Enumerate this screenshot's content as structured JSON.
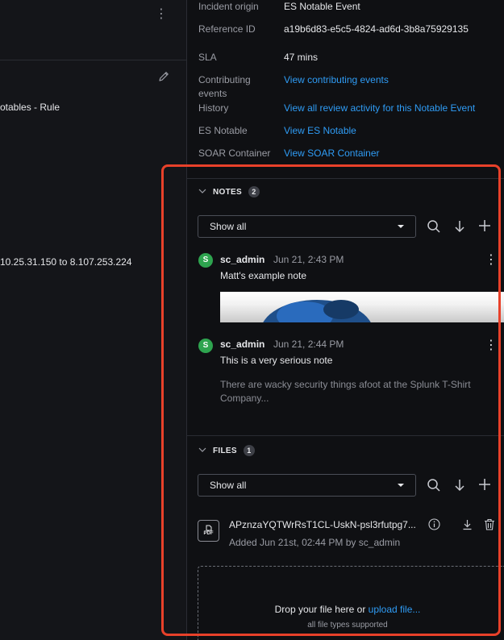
{
  "left": {
    "kebab": "⋮",
    "rule_text": "otables - Rule",
    "ip_text": "10.25.31.150 to 8.107.253.224"
  },
  "details": {
    "incident_origin": {
      "label": "Incident origin",
      "value": "ES Notable Event"
    },
    "reference_id": {
      "label": "Reference ID",
      "value": "a19b6d83-e5c5-4824-ad6d-3b8a75929135"
    },
    "sla": {
      "label": "SLA",
      "value": "47 mins"
    },
    "contributing": {
      "label_line1": "Contributing",
      "label_line2": "events",
      "value": "View contributing events"
    },
    "history": {
      "label": "History",
      "value": "View all review activity for this Notable Event"
    },
    "es_notable": {
      "label": "ES Notable",
      "value": "View ES Notable"
    },
    "soar_container": {
      "label": "SOAR Container",
      "value": "View SOAR Container"
    }
  },
  "notes": {
    "title": "NOTES",
    "count": "2",
    "filter": "Show all",
    "items": [
      {
        "avatar": "S",
        "user": "sc_admin",
        "time": "Jun 21, 2:43 PM",
        "title": "Matt's example note",
        "body": ""
      },
      {
        "avatar": "S",
        "user": "sc_admin",
        "time": "Jun 21, 2:44 PM",
        "title": "This is a very serious note",
        "body": "There are wacky security things afoot at the Splunk T-Shirt Company..."
      }
    ]
  },
  "files": {
    "title": "FILES",
    "count": "1",
    "filter": "Show all",
    "items": [
      {
        "type": "PDF",
        "name": "APznzaYQTWrRsT1CL-UskN-psl3rfutpg7...",
        "meta": "Added Jun 21st, 02:44 PM by sc_admin"
      }
    ],
    "dropzone": {
      "text": "Drop your file here or ",
      "link": "upload file...",
      "subtext": "all file types supported"
    }
  },
  "icons": {
    "chevron": "chevron-down-icon",
    "search": "search-icon",
    "sort": "arrow-down-icon",
    "add": "plus-icon",
    "info": "info-icon",
    "download": "download-icon",
    "delete": "trash-icon",
    "edit": "pencil-icon"
  },
  "colors": {
    "link": "#2f9cf5",
    "avatar": "#2ea44f",
    "highlight": "#e8412a"
  }
}
